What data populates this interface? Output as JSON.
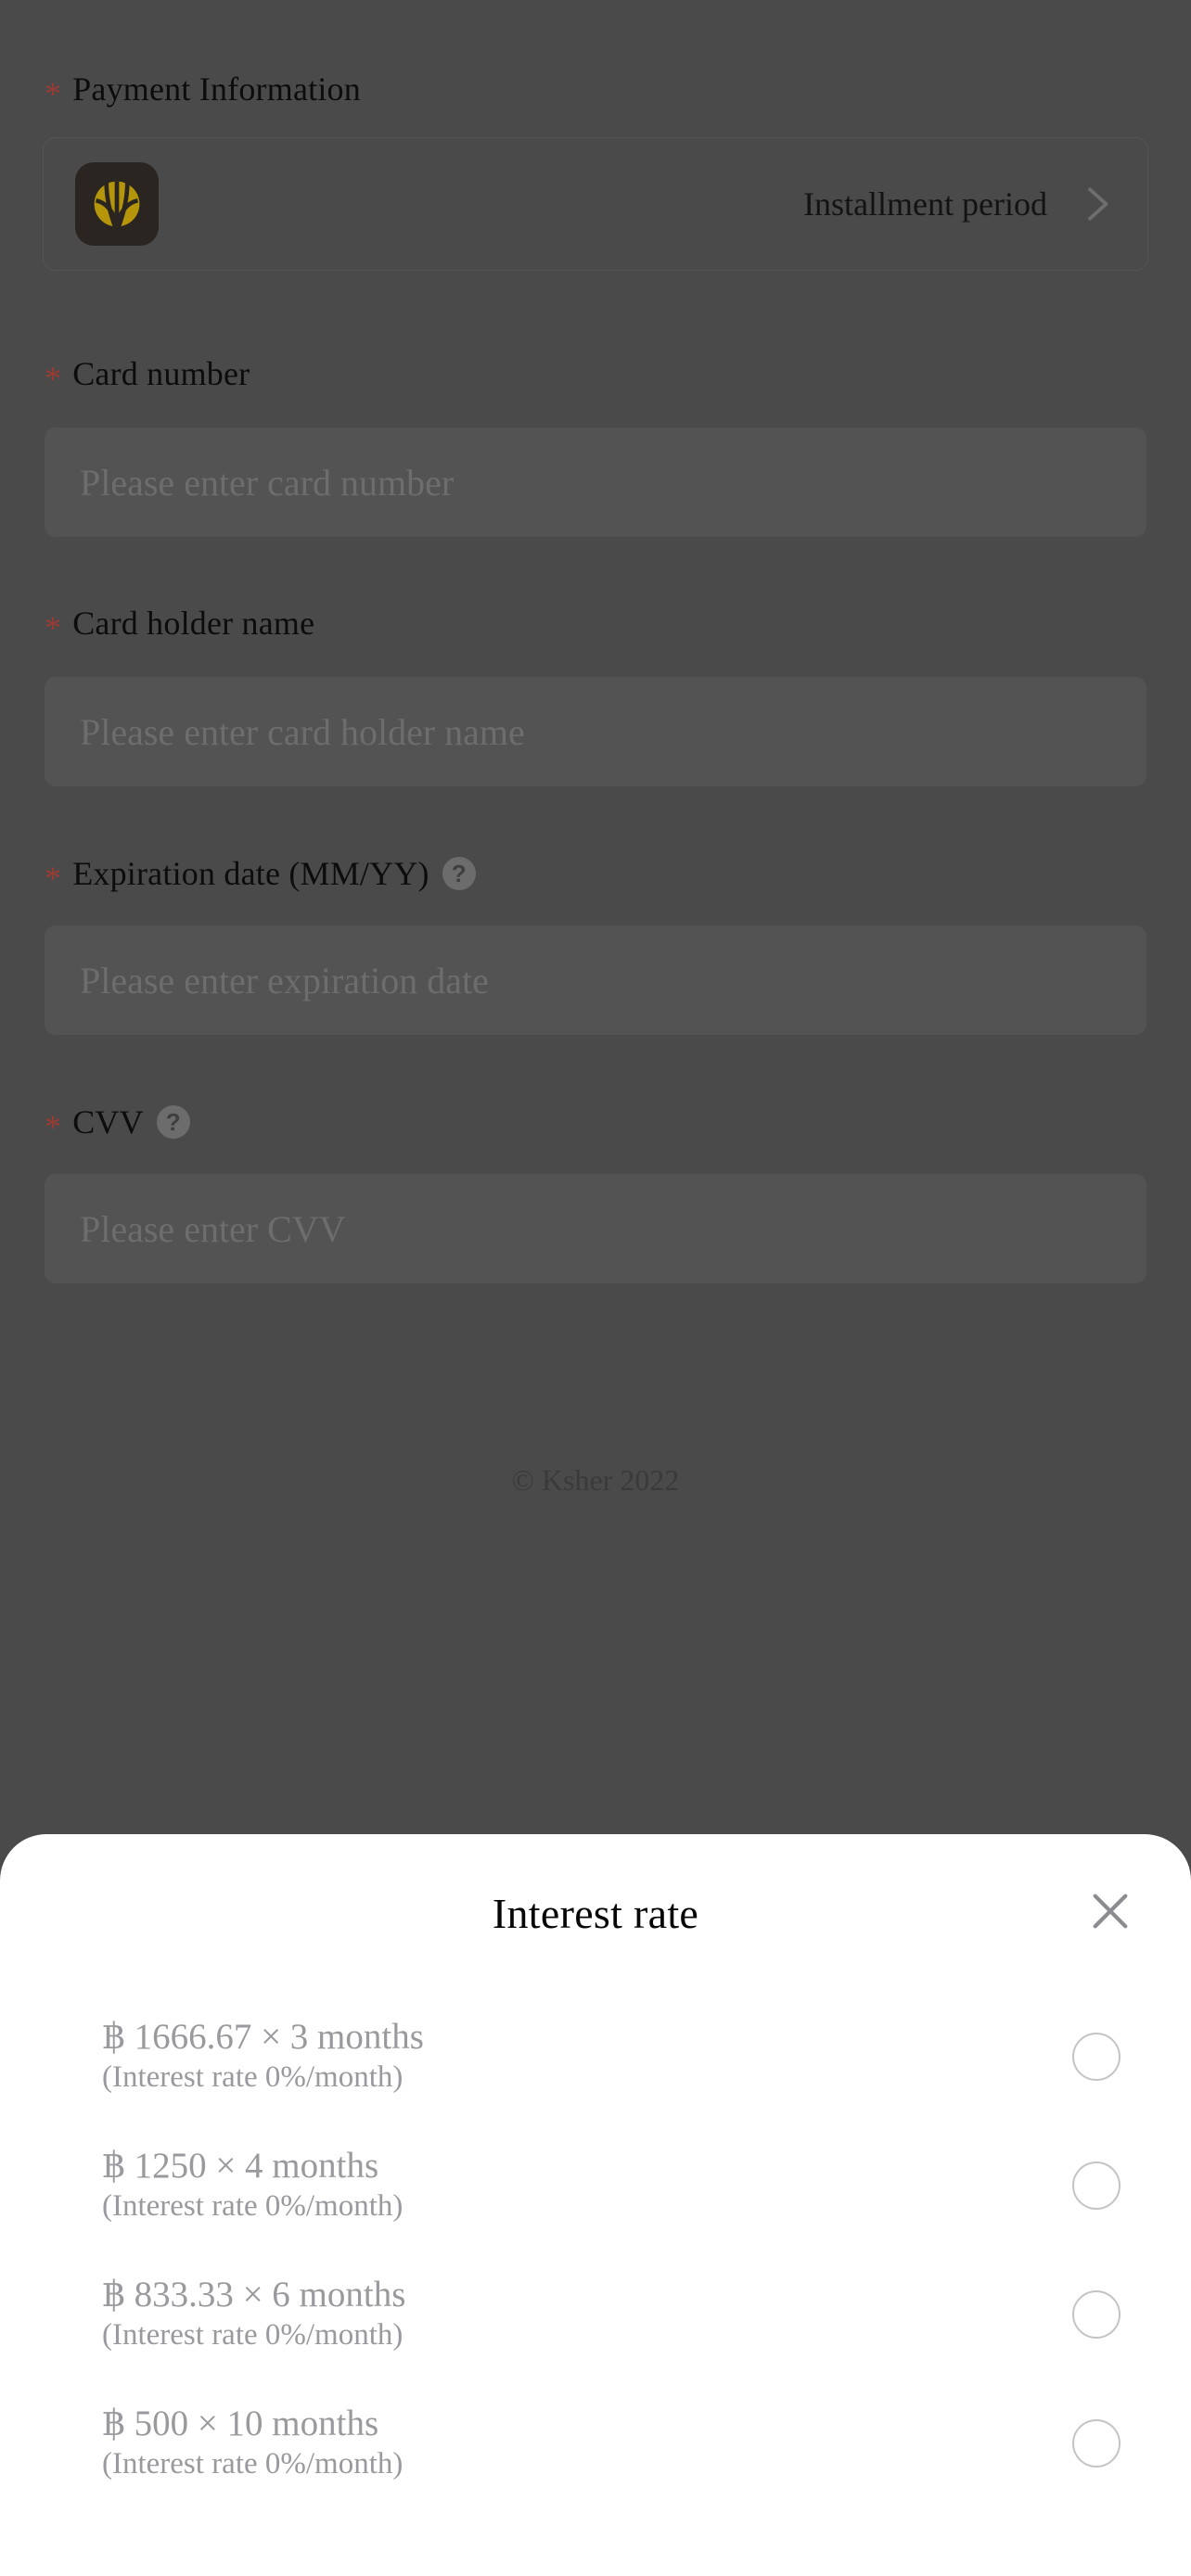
{
  "theme": {
    "overlay_bg": "#4a4a4a",
    "input_bg": "#535353",
    "sheet_bg": "#ffffff",
    "required_star_color": "#9b3b33",
    "muted_text": "#9a9a9e",
    "brand_logo_bg": "#2a2520",
    "brand_logo_fg": "#b5960a"
  },
  "form": {
    "payment_information": {
      "label": "Payment Information",
      "required_mark": "*",
      "method_row": {
        "logo_name": "krungsri-bank-logo",
        "label": "Installment period",
        "chevron_name": "chevron-right-icon"
      }
    },
    "fields": [
      {
        "id": "card-number",
        "required_mark": "*",
        "label": "Card number",
        "value": "",
        "placeholder": "Please enter card number",
        "help": null
      },
      {
        "id": "card-holder-name",
        "required_mark": "*",
        "label": "Card holder name",
        "value": "",
        "placeholder": "Please enter card holder name",
        "help": null
      },
      {
        "id": "expiration-date",
        "required_mark": "*",
        "label": "Expiration date (MM/YY)",
        "value": "",
        "placeholder": "Please enter expiration date",
        "help": "?"
      },
      {
        "id": "cvv",
        "required_mark": "*",
        "label": "CVV",
        "value": "",
        "placeholder": "Please enter CVV",
        "help": "?"
      }
    ],
    "footer": "© Ksher 2022"
  },
  "sheet": {
    "title": "Interest rate",
    "close_icon": "close-icon",
    "options": [
      {
        "main": "฿ 1666.67 × 3 months",
        "sub": "(Interest rate 0%/month)",
        "amount": "1666.67",
        "months": "3",
        "rate": "0%/month",
        "selected": false
      },
      {
        "main": "฿ 1250 × 4 months",
        "sub": "(Interest rate 0%/month)",
        "amount": "1250",
        "months": "4",
        "rate": "0%/month",
        "selected": false
      },
      {
        "main": "฿ 833.33 × 6 months",
        "sub": "(Interest rate 0%/month)",
        "amount": "833.33",
        "months": "6",
        "rate": "0%/month",
        "selected": false
      },
      {
        "main": "฿ 500 × 10 months",
        "sub": "(Interest rate 0%/month)",
        "amount": "500",
        "months": "10",
        "rate": "0%/month",
        "selected": false
      }
    ]
  }
}
